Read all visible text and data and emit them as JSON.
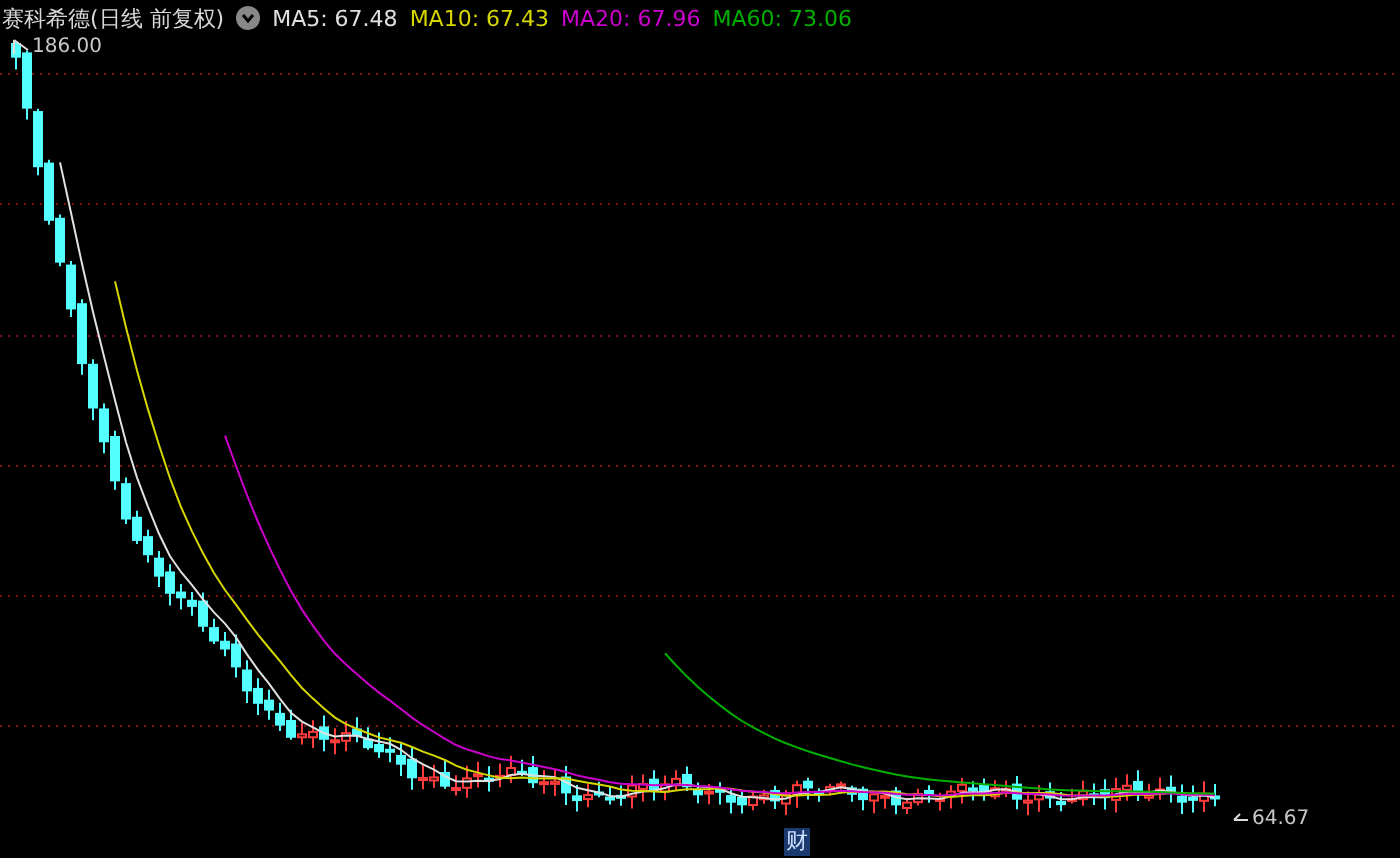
{
  "chart": {
    "title": "赛科希德(日线 前复权)",
    "legend": [
      {
        "label": "MA5: 67.48",
        "color": "#e0e0e0"
      },
      {
        "label": "MA10: 67.43",
        "color": "#d6d600"
      },
      {
        "label": "MA20: 67.96",
        "color": "#cc00cc"
      },
      {
        "label": "MA60: 73.06",
        "color": "#00b000"
      }
    ],
    "high_label": "186.00",
    "low_label": "64.67",
    "event_marker": "财"
  }
}
